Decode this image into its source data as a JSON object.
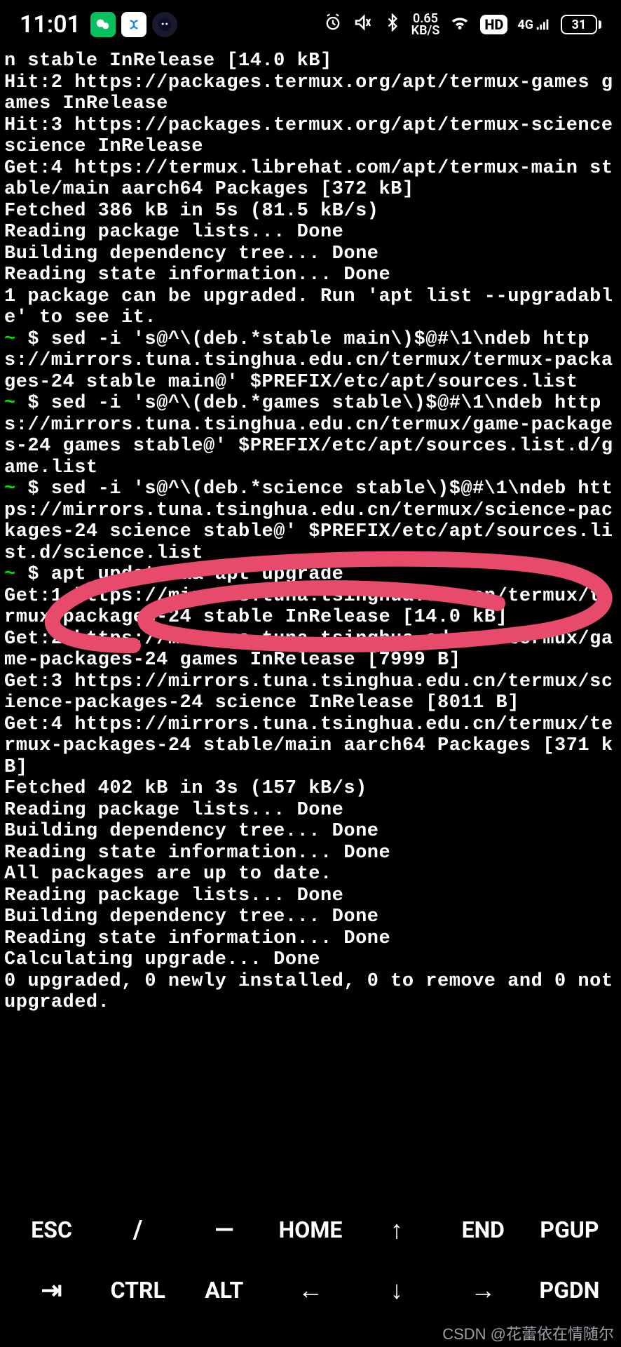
{
  "status": {
    "time": "11:01",
    "net_value": "0.65",
    "net_unit": "KB/S",
    "hd": "HD",
    "net_label": "4G",
    "battery": "31"
  },
  "term": {
    "l01": "n stable InRelease [14.0 kB]",
    "l02": "Hit:2 https://packages.termux.org/apt/termux-games games InRelease",
    "l03": "Hit:3 https://packages.termux.org/apt/termux-science science InRelease",
    "l04": "Get:4 https://termux.librehat.com/apt/termux-main stable/main aarch64 Packages [372 kB]",
    "l05": "Fetched 386 kB in 5s (81.5 kB/s)",
    "l06": "Reading package lists... Done",
    "l07": "Building dependency tree... Done",
    "l08": "Reading state information... Done",
    "l09": "1 package can be upgraded. Run 'apt list --upgradable' to see it.",
    "p1_tilde": "~",
    "p1_cmd": " $ sed -i 's@^\\(deb.*stable main\\)$@#\\1\\ndeb https://mirrors.tuna.tsinghua.edu.cn/termux/termux-packages-24 stable main@' $PREFIX/etc/apt/sources.list",
    "p2_tilde": "~",
    "p2_cmd": " $ sed -i 's@^\\(deb.*games stable\\)$@#\\1\\ndeb https://mirrors.tuna.tsinghua.edu.cn/termux/game-packages-24 games stable@' $PREFIX/etc/apt/sources.list.d/game.list",
    "p3_tilde": "~",
    "p3_cmd": " $ sed -i 's@^\\(deb.*science stable\\)$@#\\1\\ndeb https://mirrors.tuna.tsinghua.edu.cn/termux/science-packages-24 science stable@' $PREFIX/etc/apt/sources.list.d/science.list",
    "p4_tilde": "~",
    "p4_cmd": " $ apt update && apt upgrade",
    "l20": "Get:1 https://mirrors.tuna.tsinghua.edu.cn/termux/termux-packages-24 stable InRelease [14.0 kB]",
    "l21": "Get:2 https://mirrors.tuna.tsinghua.edu.cn/termux/game-packages-24 games InRelease [7999 B]",
    "l22": "Get:3 https://mirrors.tuna.tsinghua.edu.cn/termux/science-packages-24 science InRelease [8011 B]",
    "l23": "Get:4 https://mirrors.tuna.tsinghua.edu.cn/termux/termux-packages-24 stable/main aarch64 Packages [371 kB]",
    "l24": "Fetched 402 kB in 3s (157 kB/s)",
    "l25": "Reading package lists... Done",
    "l26": "Building dependency tree... Done",
    "l27": "Reading state information... Done",
    "l28": "All packages are up to date.",
    "l29": "Reading package lists... Done",
    "l30": "Building dependency tree... Done",
    "l31": "Reading state information... Done",
    "l32": "Calculating upgrade... Done",
    "l33": "0 upgraded, 0 newly installed, 0 to remove and 0 not upgraded."
  },
  "keys": {
    "row1": [
      "ESC",
      "/",
      "—",
      "HOME",
      "↑",
      "END",
      "PGUP"
    ],
    "row2": [
      "⇥",
      "CTRL",
      "ALT",
      "←",
      "↓",
      "→",
      "PGDN"
    ]
  },
  "watermark": "CSDN @花蕾依在情随尔",
  "annotation_color": "#e84a6b"
}
